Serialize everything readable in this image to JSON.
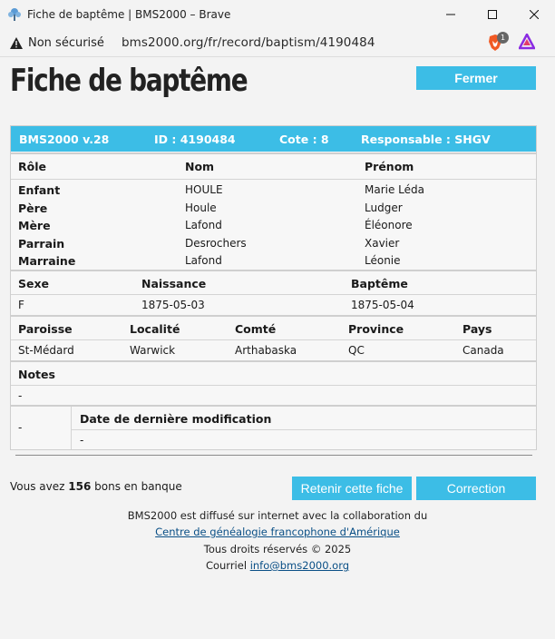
{
  "window": {
    "title": "Fiche de baptême | BMS2000 – Brave",
    "controls": [
      "minimize",
      "maximize",
      "close"
    ]
  },
  "addressbar": {
    "security": "Non sécurisé",
    "url": "bms2000.org/fr/record/baptism/4190484",
    "badge_count": "1"
  },
  "page": {
    "title": "Fiche de baptême",
    "close_label": "Fermer"
  },
  "record": {
    "header": {
      "version": "BMS2000 v.28",
      "id": "ID : 4190484",
      "cote": "Cote : 8",
      "responsable": "Responsable : SHGV"
    },
    "persons_headers": [
      "Rôle",
      "Nom",
      "Prénom"
    ],
    "persons": [
      {
        "role": "Enfant",
        "nom": "HOULE",
        "prenom": "Marie Léda"
      },
      {
        "role": "Père",
        "nom": "Houle",
        "prenom": "Ludger"
      },
      {
        "role": "Mère",
        "nom": "Lafond",
        "prenom": "Éléonore"
      },
      {
        "role": "Parrain",
        "nom": "Desrochers",
        "prenom": "Xavier"
      },
      {
        "role": "Marraine",
        "nom": "Lafond",
        "prenom": "Léonie"
      }
    ],
    "dates_headers": [
      "Sexe",
      "Naissance",
      "Baptême"
    ],
    "dates": {
      "sexe": "F",
      "naissance": "1875-05-03",
      "bapteme": "1875-05-04"
    },
    "place_headers": [
      "Paroisse",
      "Localité",
      "Comté",
      "Province",
      "Pays"
    ],
    "place": {
      "paroisse": "St-Médard",
      "localite": "Warwick",
      "comte": "Arthabaska",
      "province": "QC",
      "pays": "Canada"
    },
    "notes_header": "Notes",
    "notes": "-",
    "left_cell": "-",
    "modif_header": "Date de dernière modification",
    "modif_value": "-"
  },
  "bank": {
    "prefix": "Vous avez",
    "count": "156",
    "suffix": "bons en banque"
  },
  "actions": {
    "keep_label": "Retenir cette fiche",
    "correction_label": "Correction"
  },
  "footer": {
    "line1": "BMS2000 est diffusé sur internet avec la collaboration du",
    "link1": "Centre de généalogie francophone d'Amérique",
    "rights": "Tous droits réservés © 2025",
    "mail_prefix": "Courriel",
    "mail_link": "info@bms2000.org"
  },
  "colors": {
    "accent": "#3cbde6",
    "link": "#0a4f86"
  }
}
